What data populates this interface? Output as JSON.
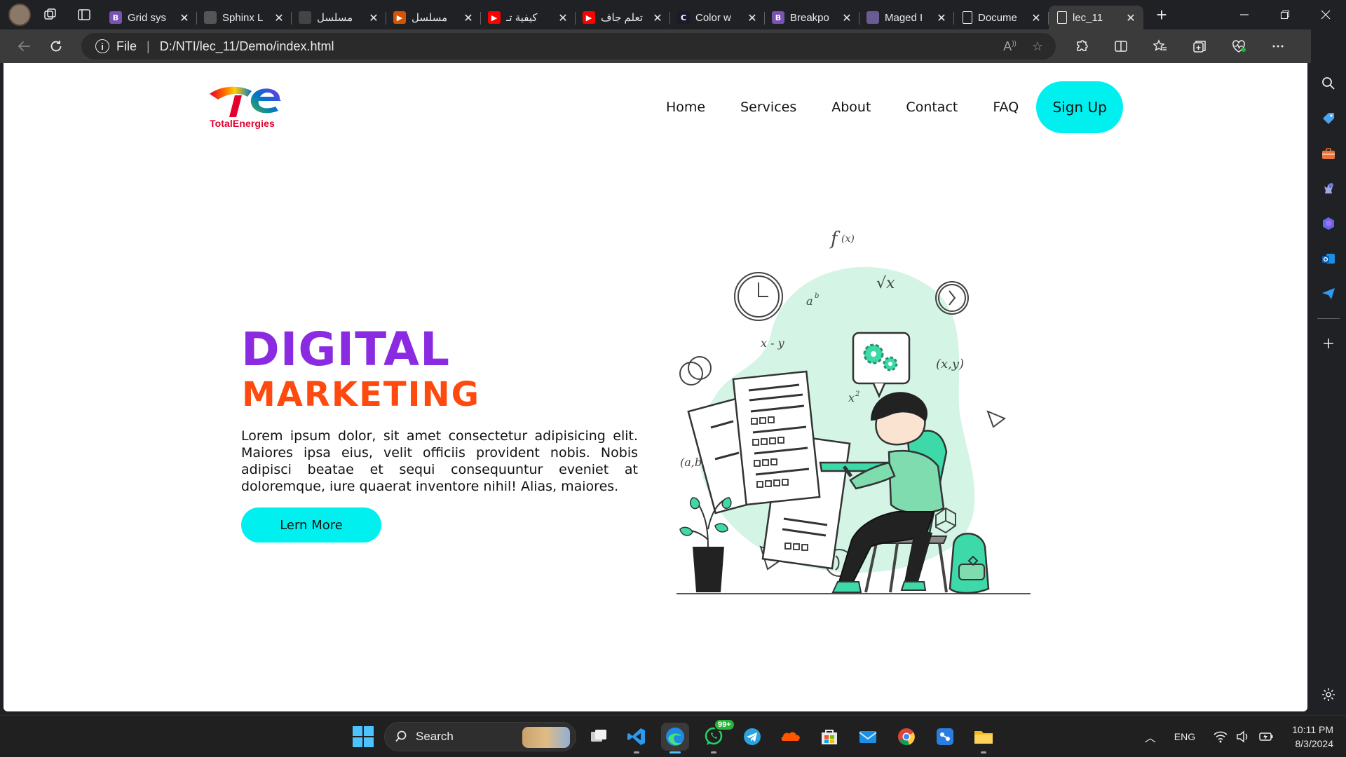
{
  "browser": {
    "tabs": [
      {
        "title": "Grid sys",
        "favicon": "bootstrap-icon",
        "color": "#7952b3",
        "glyph": "B"
      },
      {
        "title": "Sphinx L",
        "favicon": "sphinx-icon",
        "color": "#555555",
        "glyph": ""
      },
      {
        "title": "مسلسل",
        "favicon": "site-icon",
        "color": "#444444",
        "glyph": ""
      },
      {
        "title": "مسلسل",
        "favicon": "play-icon",
        "color": "#d35400",
        "glyph": "▶"
      },
      {
        "title": "كيفية تـ",
        "favicon": "youtube-icon",
        "color": "#ff0000",
        "glyph": "▶"
      },
      {
        "title": "تعلم جاف",
        "favicon": "youtube-icon",
        "color": "#ff0000",
        "glyph": "▶"
      },
      {
        "title": "Color w",
        "favicon": "color-site-icon",
        "color": "#1a1a2e",
        "glyph": "C"
      },
      {
        "title": "Breakpo",
        "favicon": "bootstrap-icon",
        "color": "#7952b3",
        "glyph": "B"
      },
      {
        "title": "Maged I",
        "favicon": "person-icon",
        "color": "#6b5b95",
        "glyph": ""
      },
      {
        "title": "Docume",
        "favicon": "document-icon",
        "color": "transparent",
        "glyph": ""
      },
      {
        "title": "lec_11",
        "favicon": "document-icon",
        "color": "transparent",
        "glyph": ""
      }
    ],
    "active_tab_index": 10,
    "address": {
      "scheme": "File",
      "url": "D:/NTI/lec_11/Demo/index.html"
    }
  },
  "site": {
    "logo_text": "TotalEnergies",
    "nav": [
      "Home",
      "Services",
      "About",
      "Contact",
      "FAQ"
    ],
    "signup_label": "Sign Up",
    "hero": {
      "title_line1": "DIGITAL",
      "title_line2": "MARKETING",
      "paragraph": "Lorem ipsum dolor, sit amet consectetur adipisicing elit. Maiores ipsa eius, velit officiis provident nobis. Nobis adipisci beatae et sequi consequuntur eveniet at doloremque, iure quaerat inventore nihil! Alias, maiores.",
      "button_label": "Lern More"
    },
    "colors": {
      "accent_cyan": "#00f0f0",
      "purple": "#8a2be2",
      "orange": "#ff4a0f"
    }
  },
  "taskbar": {
    "search_placeholder": "Search",
    "whatsapp_badge": "99+",
    "language": "ENG",
    "time": "10:11 PM",
    "date": "8/3/2024"
  }
}
